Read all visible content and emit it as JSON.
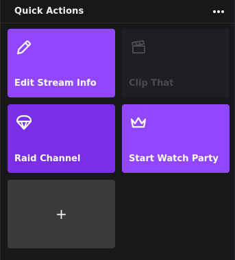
{
  "header": {
    "title": "Quick Actions",
    "menu_icon": "more-dots-icon"
  },
  "tiles": [
    {
      "label": "Edit Stream Info",
      "icon": "pencil-icon",
      "color": "#9147ff",
      "enabled": true
    },
    {
      "label": "Clip That",
      "icon": "clapperboard-icon",
      "color": "#1f1f23",
      "enabled": false
    },
    {
      "label": "Raid Channel",
      "icon": "parachute-icon",
      "color": "#7a2ee6",
      "enabled": true
    },
    {
      "label": "Start Watch Party",
      "icon": "crown-icon",
      "color": "#9147ff",
      "enabled": true
    }
  ],
  "add_tile": {
    "symbol": "+",
    "icon": "plus-icon",
    "color": "#3a3a3d"
  }
}
